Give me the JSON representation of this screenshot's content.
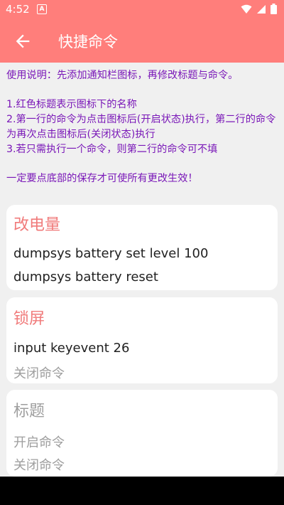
{
  "status": {
    "time": "4:52",
    "a_icon": "A"
  },
  "header": {
    "title": "快捷命令"
  },
  "instructions": {
    "usage": "使用说明：先添加通知栏图标，再修改标题与命令。",
    "rule1": "1.红色标题表示图标下的名称",
    "rule2": "2.第一行的命令为点击图标后(开启状态)执行，第二行的命令为再次点击图标后(关闭状态)执行",
    "rule3": "3.若只需执行一个命令，则第二行的命令可不填",
    "note": "一定要点底部的保存才可使所有更改生效！"
  },
  "cards": [
    {
      "title": "改电量",
      "on_command": "dumpsys battery set level 100",
      "off_command": "dumpsys battery reset"
    },
    {
      "title": "锁屏",
      "on_command": "input keyevent 26",
      "off_placeholder": "关闭命令"
    },
    {
      "title_placeholder": "标题",
      "on_placeholder": "开启命令",
      "off_placeholder": "关闭命令"
    }
  ],
  "colors": {
    "appbar": "#ff7e7b",
    "instruction_text": "#7a18b8",
    "card_title": "#f07a7a"
  }
}
